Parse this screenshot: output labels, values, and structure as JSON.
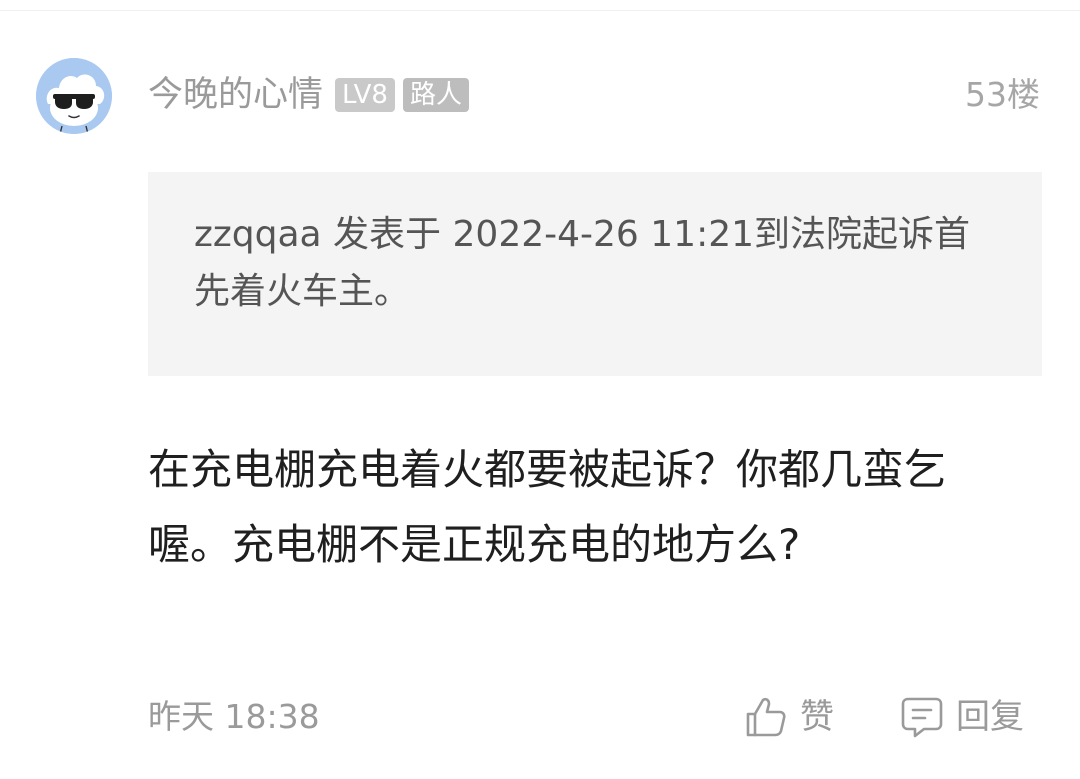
{
  "post": {
    "author": "今晚的心情",
    "level_badge": "LV8",
    "role_badge": "路人",
    "floor": "53楼",
    "quote": "zzqqaa 发表于 2022-4-26 11:21到法院起诉首先着火车主。",
    "content": "在充电棚充电着火都要被起诉？你都几蛮乞喔。充电棚不是正规充电的地方么?",
    "time": "昨天 18:38",
    "like_label": "赞",
    "reply_label": "回复"
  },
  "colors": {
    "avatar_bg": "#a9c9f0",
    "meta_text": "#9a9a9a",
    "badge_bg": "#c9c9c9",
    "quote_bg": "#f4f4f4"
  },
  "icons": {
    "avatar": "cloud-sunglasses-avatar",
    "like": "thumbs-up-icon",
    "reply": "comment-icon"
  }
}
